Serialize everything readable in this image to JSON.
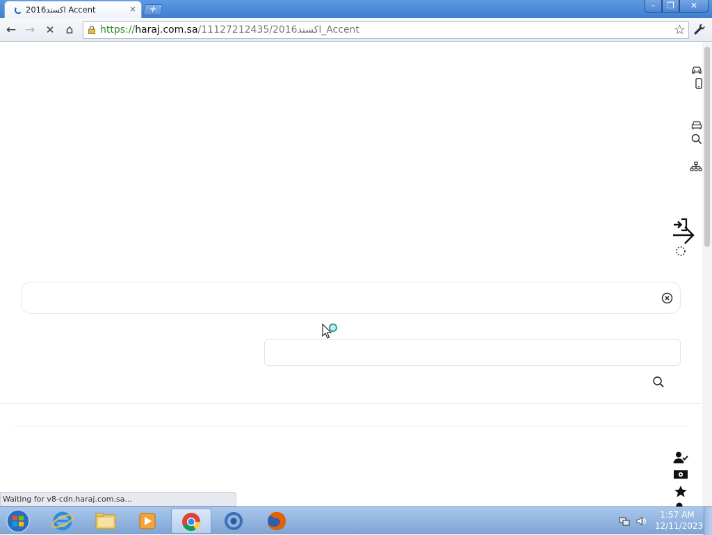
{
  "browser": {
    "tab_title": "اكسند2016 Accent",
    "tab_close": "×",
    "new_tab": "+",
    "url_scheme": "https://",
    "url_host": "haraj.com.sa",
    "url_path": "/11127212435/2016اكسند_Accent",
    "window_controls": {
      "minimize": "–",
      "maximize": "❐",
      "close": "✕"
    },
    "buttons": {
      "back": "←",
      "forward": "→",
      "stop": "✕",
      "home": "⌂",
      "bookmark": "☆"
    }
  },
  "page": {
    "status_text": "Waiting for v8-cdn.haraj.com.sa...",
    "side_icons": [
      "car-icon",
      "mobile-icon",
      "sofa-icon",
      "search-icon",
      "sitemap-icon",
      "login-icon",
      "arrow-right-icon",
      "loading-spinner-icon",
      "user-check-icon",
      "money-icon",
      "star-icon"
    ]
  },
  "taskbar": {
    "apps": [
      "internet-explorer-icon",
      "file-explorer-icon",
      "media-player-icon",
      "chrome-icon",
      "chromium-icon",
      "firefox-icon"
    ],
    "active_app": "chrome-icon",
    "clock_time": "1:57 AM",
    "clock_date": "12/11/2023"
  },
  "colors": {
    "accent_blue": "#3f7dd0",
    "url_green": "#2e8b2e",
    "taskbar": "#7ea4d3"
  }
}
